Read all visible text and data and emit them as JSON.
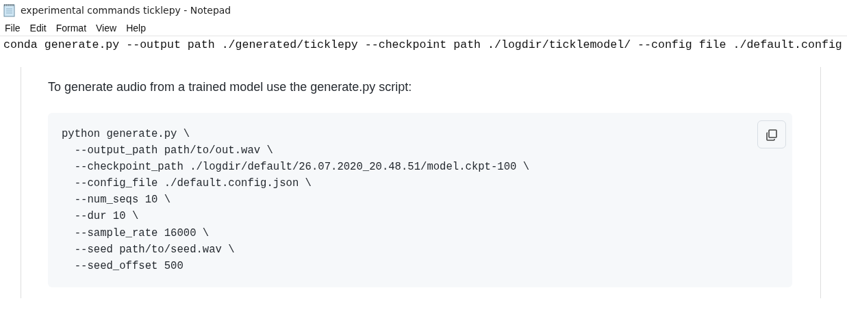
{
  "window": {
    "title": "experimental commands ticklepy - Notepad"
  },
  "menu": [
    "File",
    "Edit",
    "Format",
    "View",
    "Help"
  ],
  "editor": {
    "text": "conda generate.py --output path ./generated/ticklepy --checkpoint path ./logdir/ticklemodel/ --config file ./default.config"
  },
  "embedded_page": {
    "paragraph": "To generate audio from a trained model use the generate.py script:",
    "code_lines": [
      "python generate.py \\",
      "  --output_path path/to/out.wav \\",
      "  --checkpoint_path ./logdir/default/26.07.2020_20.48.51/model.ckpt-100 \\",
      "  --config_file ./default.config.json \\",
      "  --num_seqs 10 \\",
      "  --dur 10 \\",
      "  --sample_rate 16000 \\",
      "  --seed path/to/seed.wav \\",
      "  --seed_offset 500"
    ]
  }
}
